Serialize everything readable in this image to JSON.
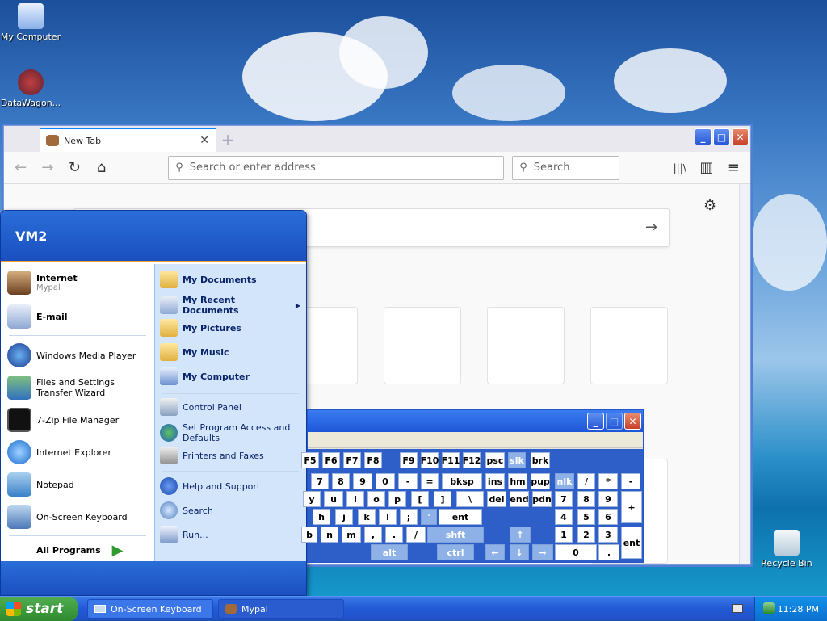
{
  "desktop": {
    "icons": [
      {
        "label": "My Computer",
        "icon": "my-computer-icon"
      },
      {
        "label": "DataWagon...",
        "icon": "datawagon-icon"
      },
      {
        "label": "Recycle Bin",
        "icon": "recycle-bin-icon"
      }
    ]
  },
  "browser": {
    "tab_title": "New Tab",
    "tab_close": "✕",
    "new_tab": "+",
    "url_placeholder": "Search or enter address",
    "search_placeholder": "Search",
    "back": "←",
    "forward": "→",
    "reload": "↻",
    "home": "⌂",
    "library": "|||\\",
    "sidebar": "▥",
    "menu": "≡",
    "settings": "⚙",
    "go_arrow": "→",
    "win_min": "_",
    "win_max": "□",
    "win_close": "✕"
  },
  "startmenu": {
    "user": "VM2",
    "left_items": [
      {
        "label": "Internet",
        "sub": "Mypal",
        "icon": "mypal-icon"
      },
      {
        "label": "E-mail",
        "icon": "email-icon"
      },
      {
        "label": "Windows Media Player",
        "icon": "media-player-icon"
      },
      {
        "label": "Files and Settings Transfer Wizard",
        "icon": "transfer-wizard-icon"
      },
      {
        "label": "7-Zip File Manager",
        "icon": "7zip-icon"
      },
      {
        "label": "Internet Explorer",
        "icon": "ie-icon"
      },
      {
        "label": "Notepad",
        "icon": "notepad-icon"
      },
      {
        "label": "On-Screen Keyboard",
        "icon": "keyboard-icon"
      }
    ],
    "all_programs": "All Programs",
    "right_items": [
      {
        "label": "My Documents",
        "icon": "folder-icon"
      },
      {
        "label": "My Recent Documents",
        "icon": "recent-docs-icon"
      },
      {
        "label": "My Pictures",
        "icon": "pictures-folder-icon"
      },
      {
        "label": "My Music",
        "icon": "music-folder-icon"
      },
      {
        "label": "My Computer",
        "icon": "my-computer-icon"
      },
      {
        "label": "Control Panel",
        "icon": "control-panel-icon"
      },
      {
        "label": "Set Program Access and Defaults",
        "icon": "program-access-icon"
      },
      {
        "label": "Printers and Faxes",
        "icon": "printer-icon"
      },
      {
        "label": "Help and Support",
        "icon": "help-icon"
      },
      {
        "label": "Search",
        "icon": "search-icon"
      },
      {
        "label": "Run...",
        "icon": "run-icon"
      }
    ],
    "submenu_arrow": "▶"
  },
  "osk": {
    "win_min": "_",
    "win_max": "□",
    "win_close": "✕",
    "row1": [
      "F5",
      "F6",
      "F7",
      "F8",
      "F9",
      "F10",
      "F11",
      "F12",
      "psc",
      "slk",
      "brk"
    ],
    "row2": [
      "7",
      "8",
      "9",
      "0",
      "-",
      "=",
      "bksp",
      "ins",
      "hm",
      "pup",
      "nlk",
      "/",
      "*",
      "-"
    ],
    "row3": [
      "y",
      "u",
      "i",
      "o",
      "p",
      "[",
      "]",
      "\\",
      "del",
      "end",
      "pdn",
      "7",
      "8",
      "9",
      "+"
    ],
    "row4": [
      "h",
      "j",
      "k",
      "l",
      ";",
      "'",
      "ent",
      "4",
      "5",
      "6"
    ],
    "row5": [
      "b",
      "n",
      "m",
      ",",
      ".",
      "/",
      "shft",
      "↑",
      "1",
      "2",
      "3",
      "ent"
    ],
    "row6": [
      "alt",
      "ctrl",
      "←",
      "↓",
      "→",
      "0",
      "."
    ]
  },
  "taskbar": {
    "start": "start",
    "buttons": [
      {
        "label": "On-Screen Keyboard",
        "icon": "keyboard-icon"
      },
      {
        "label": "Mypal",
        "icon": "mypal-icon"
      }
    ],
    "clock": "11:28 PM"
  }
}
